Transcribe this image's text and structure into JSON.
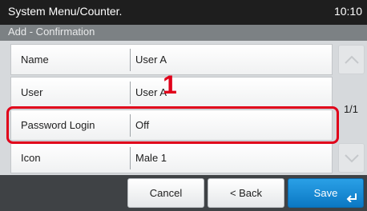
{
  "header": {
    "title": "System Menu/Counter.",
    "clock": "10:10"
  },
  "subheader": {
    "title": "Add - Confirmation"
  },
  "rows": [
    {
      "label": "Name",
      "value": "User A"
    },
    {
      "label": "User",
      "value": "User A"
    },
    {
      "label": "Password Login",
      "value": "Off"
    },
    {
      "label": "Icon",
      "value": "Male 1"
    }
  ],
  "pagination": {
    "indicator": "1/1",
    "up_icon": "chevron-up-icon",
    "down_icon": "chevron-down-icon"
  },
  "callout": {
    "step_number": "1",
    "highlighted_row": "Password Login",
    "color": "#e0001a"
  },
  "footer": {
    "cancel_label": "Cancel",
    "back_label": "< Back",
    "save_label": "Save",
    "save_icon": "enter-icon"
  },
  "colors": {
    "header_bg": "#1e1e1e",
    "subheader_bg": "#7c8184",
    "body_bg": "#d6d9dc",
    "footer_bg": "#3f4245",
    "primary_button": "#0b78c4"
  }
}
